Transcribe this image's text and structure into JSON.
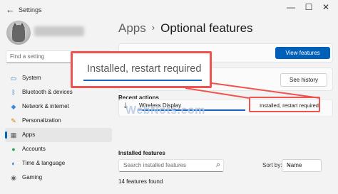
{
  "window": {
    "back_glyph": "←",
    "title": "Settings",
    "minimize_glyph": "—",
    "maximize_glyph": "☐",
    "close_glyph": "✕"
  },
  "sidebar": {
    "search_placeholder": "Find a setting",
    "search_icon": "⌕",
    "items": [
      {
        "label": "System",
        "icon": "system-icon",
        "glyph": "▭",
        "color": "#1a73c8"
      },
      {
        "label": "Bluetooth & devices",
        "icon": "bluetooth-icon",
        "glyph": "ᛒ",
        "color": "#1a73c8"
      },
      {
        "label": "Network & internet",
        "icon": "wifi-icon",
        "glyph": "◆",
        "color": "#3a8ad8"
      },
      {
        "label": "Personalization",
        "icon": "brush-icon",
        "glyph": "✎",
        "color": "#d07a18"
      },
      {
        "label": "Apps",
        "icon": "apps-icon",
        "glyph": "▦",
        "color": "#555555"
      },
      {
        "label": "Accounts",
        "icon": "account-icon",
        "glyph": "●",
        "color": "#2aa55a"
      },
      {
        "label": "Time & language",
        "icon": "globe-icon",
        "glyph": "◐",
        "color": "#1a73c8"
      },
      {
        "label": "Gaming",
        "icon": "gamepad-icon",
        "glyph": "◉",
        "color": "#666666"
      }
    ],
    "active_index": 4
  },
  "main": {
    "breadcrumb_parent": "Apps",
    "breadcrumb_sep": "›",
    "breadcrumb_current": "Optional features",
    "view_features_label": "View features",
    "see_history_label": "See history",
    "recent_actions_label": "Recent actions",
    "recent_item_icon": "⤓",
    "recent_item_name": "Wireless Display",
    "recent_item_status": "Installed, restart required",
    "installed_features_label": "Installed features",
    "search_placeholder": "Search installed features",
    "search_icon": "⌕",
    "sort_by_label": "Sort by:",
    "sort_value": "Name",
    "sort_chevron": "⌄",
    "feature_count": "14 features found"
  },
  "annotation": {
    "callout_text": "Installed, restart required",
    "watermark": "WebNots.com",
    "callout_color": "#ef5350",
    "underline_color": "#1565c0"
  }
}
